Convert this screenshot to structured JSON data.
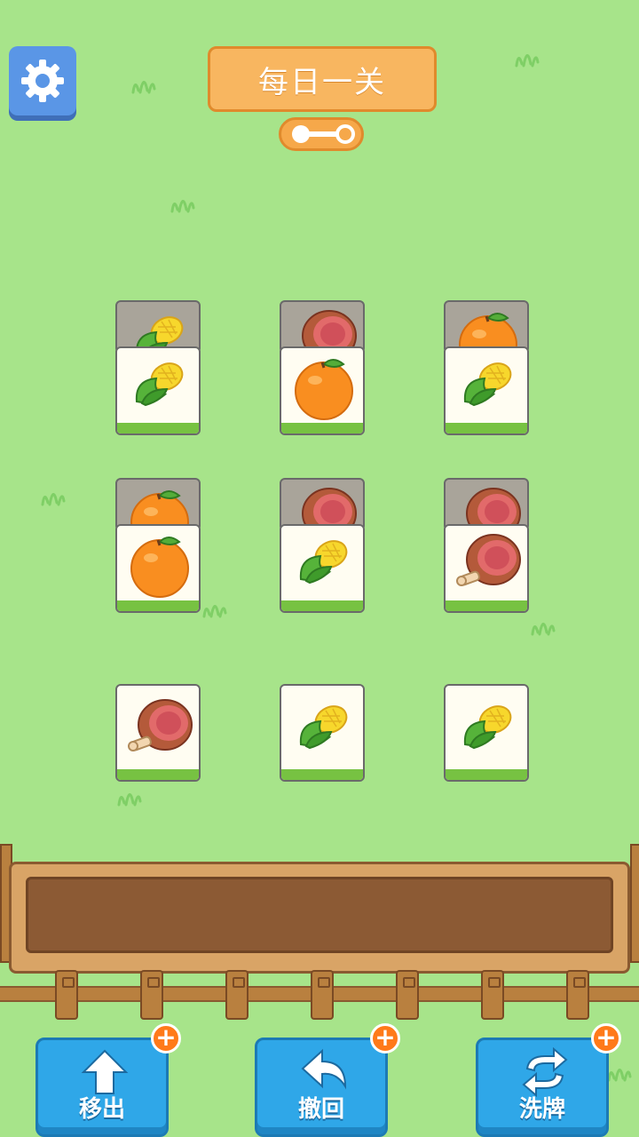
{
  "header": {
    "title": "每日一关"
  },
  "progress": {
    "stage": 1,
    "total": 2
  },
  "tiles": {
    "row1": [
      "corn",
      "orange",
      "corn"
    ],
    "row1_behind": [
      "corn",
      "ham",
      "orange"
    ],
    "row2": [
      "orange",
      "corn",
      "ham"
    ],
    "row2_behind": [
      "orange",
      "ham",
      "ham"
    ],
    "row3": [
      "ham",
      "corn",
      "corn"
    ]
  },
  "buttons": {
    "remove": {
      "label": "移出",
      "badge": "+"
    },
    "undo": {
      "label": "撤回",
      "badge": "+"
    },
    "shuffle": {
      "label": "洗牌",
      "badge": "+"
    }
  },
  "colors": {
    "background": "#a7e48a",
    "title_bg": "#f8b660",
    "button_bg": "#2fa7e8",
    "badge": "#ff7a1a"
  }
}
